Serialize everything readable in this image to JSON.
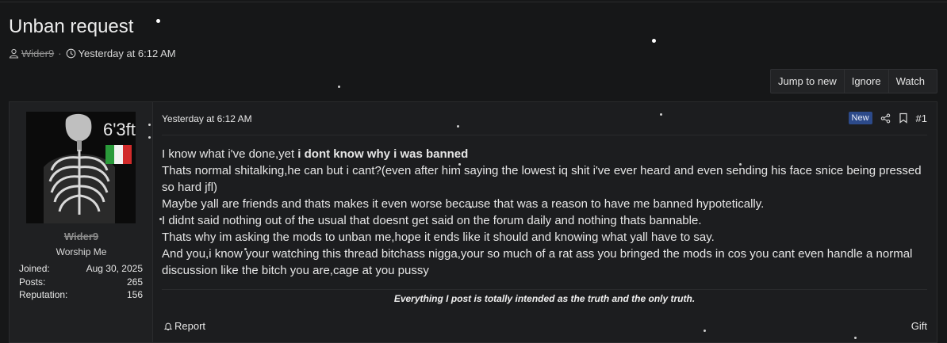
{
  "thread": {
    "title": "Unban request",
    "author": "Wider9",
    "meta_separator": "·",
    "started": "Yesterday at 6:12 AM"
  },
  "actions": [
    "Jump to new",
    "Ignore",
    "Watch"
  ],
  "post": {
    "date": "Yesterday at 6:12 AM",
    "badge": "New",
    "number": "#1",
    "body": {
      "line1_plain": "I know what i've done,yet ",
      "line1_bold": "i dont know why i was banned",
      "paragraphs": [
        "Thats normal shitalking,he can but i cant?(even after him saying the lowest iq shit i've ever heard and even sending his face snice being pressed so hard jfl)",
        "Maybe yall are friends and thats makes it even worse because that was a reason to have me banned hypotetically.",
        "I didnt said nothing out of the usual that doesnt get said on the forum daily and nothing thats bannable.",
        "Thats why im asking the mods to unban me,hope it ends like it should and knowing what yall have to say.",
        "And you,i know your watching this thread bitchass nigga,your so much of a rat ass you bringed the mods in cos you cant even handle a normal discussion like the bitch you are,cage at you pussy"
      ]
    },
    "signature": "Everything I post is totally intended as the truth and the only truth.",
    "report_label": "Report",
    "gift_label": "Gift"
  },
  "user": {
    "avatar_text": "6'3ft",
    "name": "Wider9",
    "title": "Worship Me",
    "stats": [
      {
        "label": "Joined:",
        "value": "Aug 30, 2025"
      },
      {
        "label": "Posts:",
        "value": "265"
      },
      {
        "label": "Reputation:",
        "value": "156"
      }
    ]
  },
  "colors": {
    "background": "#161718",
    "panel": "#1c1d1f",
    "badge_new": "#2c4a8a",
    "muted_text": "#8c8c8c"
  },
  "icons": [
    "user-icon",
    "clock-icon",
    "share-icon",
    "bookmark-icon",
    "bell-icon"
  ]
}
